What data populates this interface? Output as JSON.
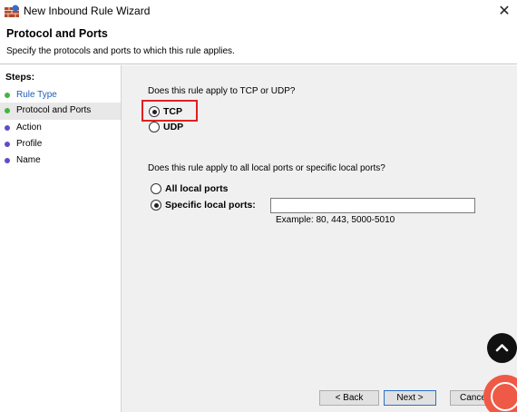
{
  "window": {
    "title": "New Inbound Rule Wizard",
    "close_glyph": "✕"
  },
  "header": {
    "title": "Protocol and Ports",
    "subtitle": "Specify the protocols and ports to which this rule applies."
  },
  "sidebar": {
    "steps_label": "Steps:",
    "items": [
      {
        "label": "Rule Type",
        "state": "done"
      },
      {
        "label": "Protocol and Ports",
        "state": "current"
      },
      {
        "label": "Action",
        "state": "pending"
      },
      {
        "label": "Profile",
        "state": "pending"
      },
      {
        "label": "Name",
        "state": "pending"
      }
    ]
  },
  "protocol": {
    "question": "Does this rule apply to TCP or UDP?",
    "options": [
      {
        "label": "TCP",
        "checked": true
      },
      {
        "label": "UDP",
        "checked": false
      }
    ]
  },
  "ports": {
    "question": "Does this rule apply to all local ports or specific local ports?",
    "options": [
      {
        "label": "All local ports",
        "checked": false
      },
      {
        "label": "Specific local ports:",
        "checked": true
      }
    ],
    "input_value": "",
    "example": "Example: 80, 443, 5000-5010"
  },
  "buttons": {
    "back": "< Back",
    "next": "Next >",
    "cancel": "Cancel"
  },
  "colors": {
    "highlight": "#e02020",
    "done_dot": "#3fb73f",
    "pending_dot": "#5b4fc9",
    "link": "#1d5fb5",
    "notification": "#ef5a46"
  },
  "icons": {
    "app": "firewall-wall-icon",
    "scroll_top": "chevron-up-icon",
    "notification": "bell-icon"
  }
}
